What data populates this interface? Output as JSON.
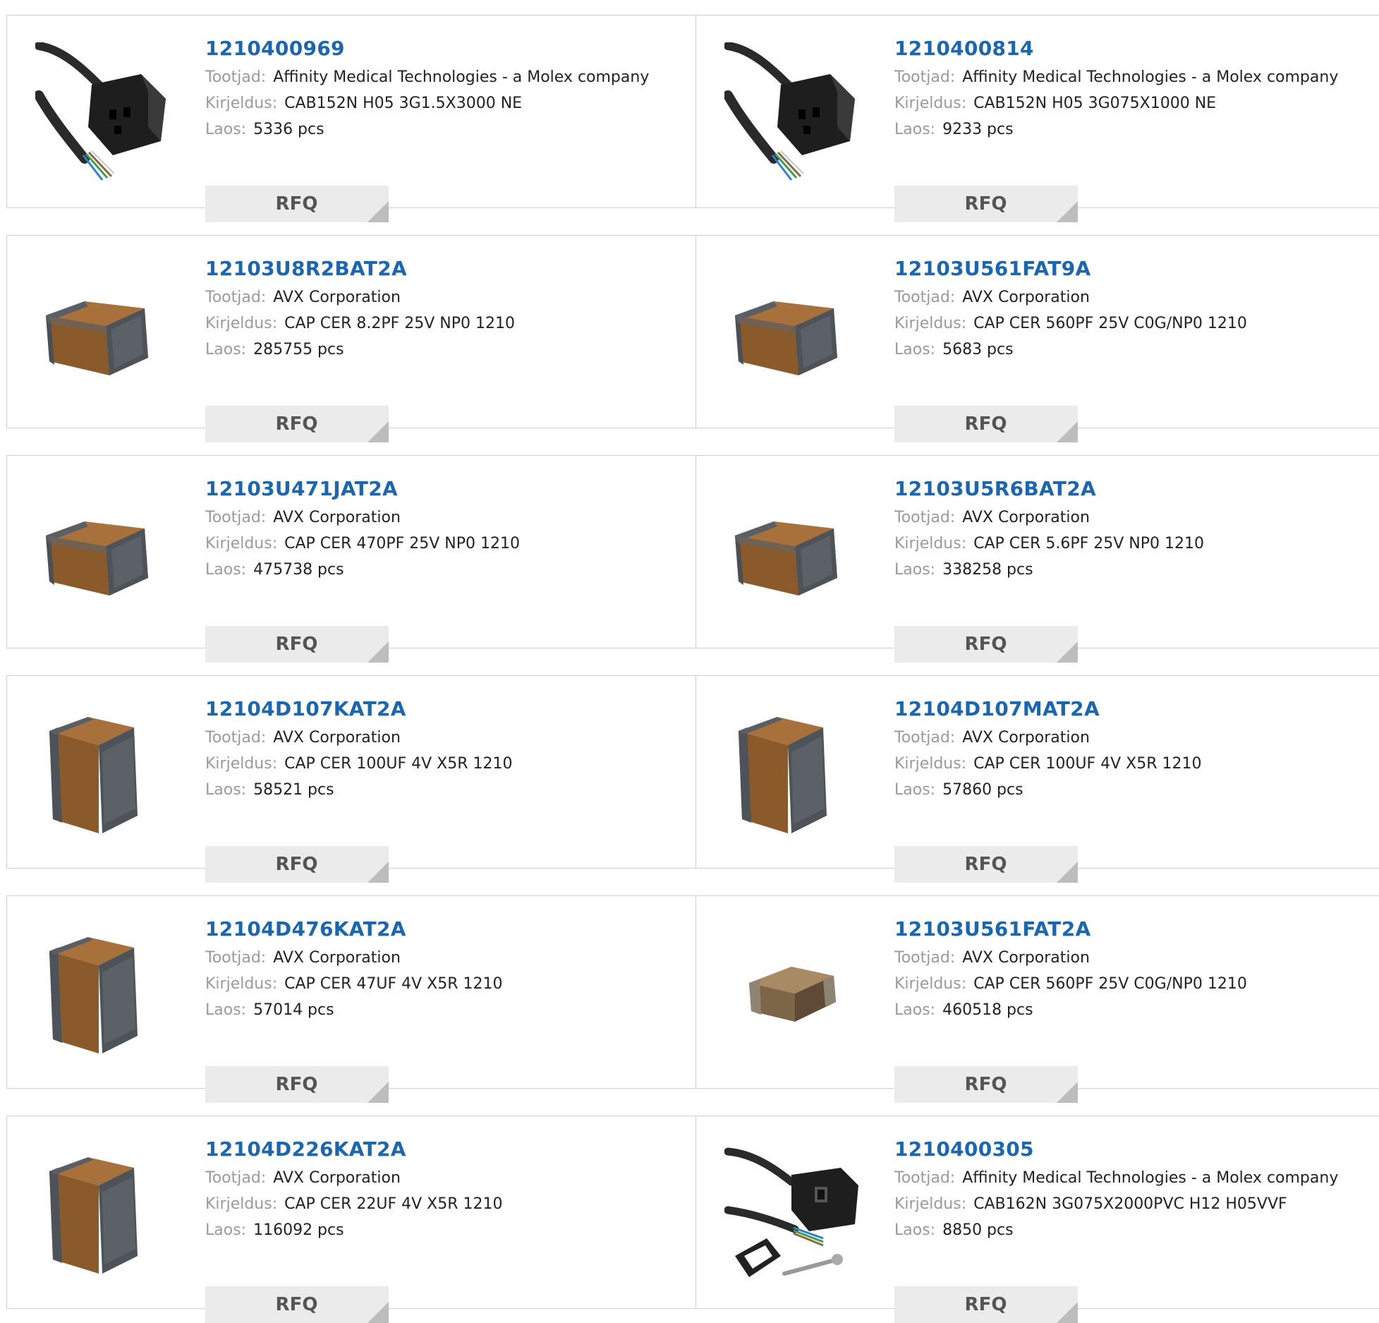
{
  "labels": {
    "manufacturer": "Tootjad:",
    "description": "Kirjeldus:",
    "stock": "Laos:",
    "rfq": "RFQ"
  },
  "colors": {
    "part_link": "#1a66b0",
    "label": "#9a9a9a",
    "rfq_bg": "#ebebeb",
    "border": "#cfcfcf"
  },
  "products": [
    {
      "part": "1210400969",
      "manufacturer": "Affinity Medical Technologies - a Molex company",
      "description": "CAB152N H05 3G1.5X3000 NE",
      "stock": "5336 pcs",
      "image": "cable-connector-icon"
    },
    {
      "part": "1210400814",
      "manufacturer": "Affinity Medical Technologies - a Molex company",
      "description": "CAB152N H05 3G075X1000 NE",
      "stock": "9233 pcs",
      "image": "cable-connector-icon"
    },
    {
      "part": "12103U8R2BAT2A",
      "manufacturer": "AVX Corporation",
      "description": "CAP CER 8.2PF 25V NP0 1210",
      "stock": "285755 pcs",
      "image": "capacitor-flat-icon"
    },
    {
      "part": "12103U561FAT9A",
      "manufacturer": "AVX Corporation",
      "description": "CAP CER 560PF 25V C0G/NP0 1210",
      "stock": "5683 pcs",
      "image": "capacitor-flat-icon"
    },
    {
      "part": "12103U471JAT2A",
      "manufacturer": "AVX Corporation",
      "description": "CAP CER 470PF 25V NP0 1210",
      "stock": "475738 pcs",
      "image": "capacitor-flat-icon"
    },
    {
      "part": "12103U5R6BAT2A",
      "manufacturer": "AVX Corporation",
      "description": "CAP CER 5.6PF 25V NP0 1210",
      "stock": "338258 pcs",
      "image": "capacitor-flat-icon"
    },
    {
      "part": "12104D107KAT2A",
      "manufacturer": "AVX Corporation",
      "description": "CAP CER 100UF 4V X5R 1210",
      "stock": "58521 pcs",
      "image": "capacitor-cube-icon"
    },
    {
      "part": "12104D107MAT2A",
      "manufacturer": "AVX Corporation",
      "description": "CAP CER 100UF 4V X5R 1210",
      "stock": "57860 pcs",
      "image": "capacitor-cube-icon"
    },
    {
      "part": "12104D476KAT2A",
      "manufacturer": "AVX Corporation",
      "description": "CAP CER 47UF 4V X5R 1210",
      "stock": "57014 pcs",
      "image": "capacitor-cube-icon"
    },
    {
      "part": "12103U561FAT2A",
      "manufacturer": "AVX Corporation",
      "description": "CAP CER 560PF 25V C0G/NP0 1210",
      "stock": "460518 pcs",
      "image": "capacitor-chip-icon"
    },
    {
      "part": "12104D226KAT2A",
      "manufacturer": "AVX Corporation",
      "description": "CAP CER 22UF 4V X5R 1210",
      "stock": "116092 pcs",
      "image": "capacitor-cube-icon"
    },
    {
      "part": "1210400305",
      "manufacturer": "Affinity Medical Technologies - a Molex company",
      "description": "CAB162N 3G075X2000PVC H12 H05VVF",
      "stock": "8850 pcs",
      "image": "cable-connector-kit-icon"
    }
  ]
}
